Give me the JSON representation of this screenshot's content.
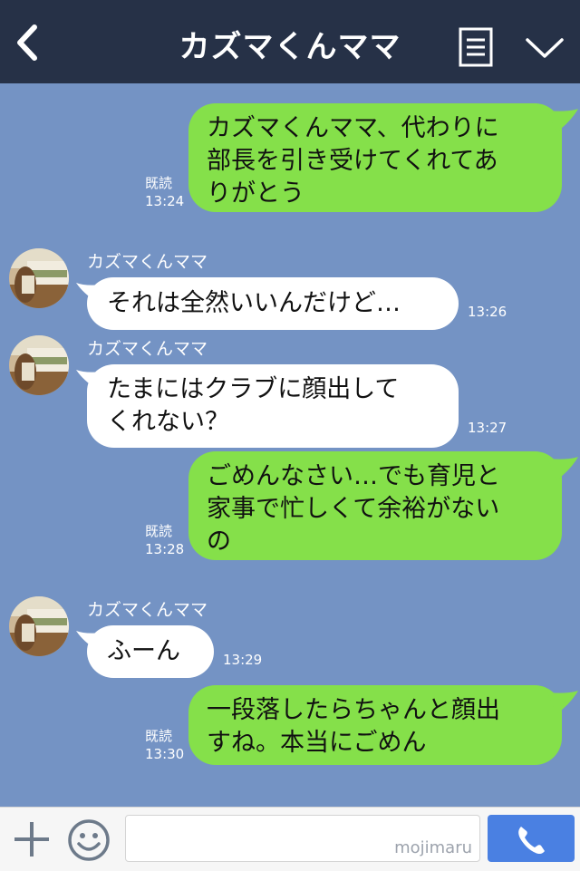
{
  "header": {
    "title": "カズマくんママ",
    "back_icon": "chevron-left-icon",
    "menu_icon": "notes-icon",
    "more_icon": "chevron-down-icon"
  },
  "messages": [
    {
      "type": "sent",
      "text": "カズマくんママ、代わりに\n部長を引き受けてくれてあ\nりがとう",
      "read": "既読",
      "time": "13:24"
    },
    {
      "type": "received",
      "sender": "カズマくんママ",
      "text": "それは全然いいんだけど…",
      "time": "13:26"
    },
    {
      "type": "received",
      "sender": "カズマくんママ",
      "text": "たまにはクラブに顔出して\nくれない？",
      "time": "13:27"
    },
    {
      "type": "sent",
      "text": "ごめんなさい…でも育児と\n家事で忙しくて余裕がない\nの",
      "read": "既読",
      "time": "13:28"
    },
    {
      "type": "received",
      "sender": "カズマくんママ",
      "text": "ふーん",
      "time": "13:29"
    },
    {
      "type": "sent",
      "text": "一段落したらちゃんと顔出\nすね。本当にごめん",
      "read": "既読",
      "time": "13:30"
    }
  ],
  "input_bar": {
    "plus_icon": "plus-icon",
    "emoji_icon": "smiley-icon",
    "watermark": "mojimaru",
    "call_icon": "phone-icon"
  },
  "colors": {
    "header_bg": "#263147",
    "chat_bg": "#7493c4",
    "sent_bubble": "#85e04a",
    "received_bubble": "#ffffff",
    "call_button": "#4a80e2"
  }
}
